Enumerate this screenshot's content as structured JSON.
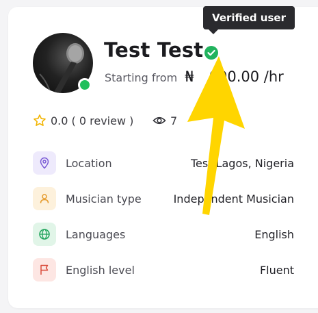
{
  "tooltip": {
    "text": "Verified user"
  },
  "profile": {
    "name": "Test Test",
    "starting_label": "Starting from",
    "price": "₦",
    "price_tail": "000.00 /hr",
    "online": true
  },
  "stats": {
    "rating": "0.0",
    "reviews": "( 0 review )",
    "views": "7"
  },
  "details": [
    {
      "label": "Location",
      "value": "Test Lagos, Nigeria",
      "value_visible": "Tes    agos, Nigeria",
      "icon": "location-pin-icon",
      "color": "#7b5cd6",
      "bg": "#eeeafc"
    },
    {
      "label": "Musician type",
      "value": "Independent Musician",
      "icon": "user-icon",
      "color": "#e59a2b",
      "bg": "#fdf1dc"
    },
    {
      "label": "Languages",
      "value": "English",
      "icon": "globe-icon",
      "color": "#1fa35a",
      "bg": "#e1f5e8"
    },
    {
      "label": "English level",
      "value": "Fluent",
      "icon": "flag-icon",
      "color": "#d94a3a",
      "bg": "#fde6e3"
    }
  ],
  "colors": {
    "online": "#1fbf5c",
    "verified": "#22b35e",
    "arrow": "#ffd500",
    "star": "#f2b400"
  }
}
